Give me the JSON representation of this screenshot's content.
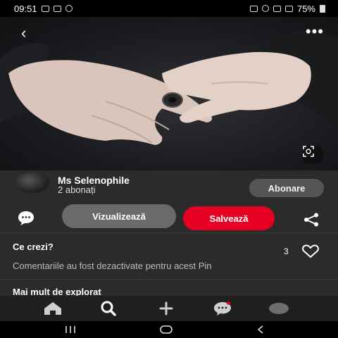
{
  "status_bar": {
    "time": "09:51",
    "battery": "75%"
  },
  "pin": {
    "author_name": "Ms Selenophile",
    "followers": "2 abonați",
    "follow_label": "Abonare",
    "visit_label": "Vizualizează",
    "save_label": "Salvează"
  },
  "comments": {
    "title": "Ce crezi?",
    "like_count": "3",
    "disabled_note": "Comentariile au fost dezactivate pentru acest Pin"
  },
  "explore": {
    "title": "Mai mult de explorat"
  },
  "bottom_nav": {
    "items": [
      "home-icon",
      "search-icon",
      "create-icon",
      "messages-icon",
      "profile-avatar"
    ]
  },
  "colors": {
    "accent": "#e60023",
    "background": "#2b2b2b"
  }
}
